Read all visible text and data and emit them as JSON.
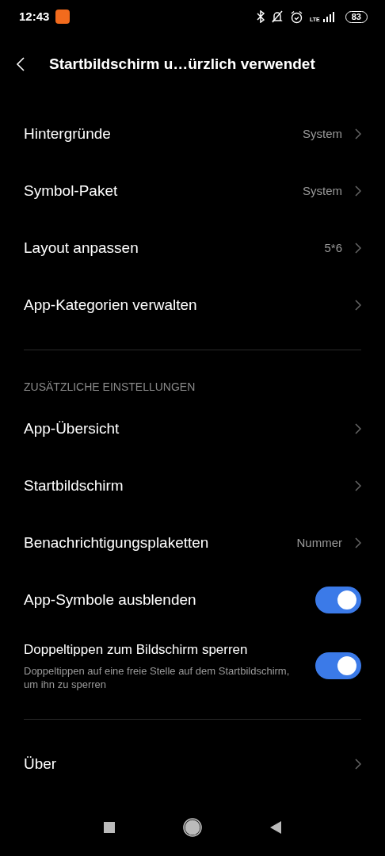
{
  "status_bar": {
    "time": "12:43",
    "network": "LTE",
    "battery": "83"
  },
  "header": {
    "title": "Startbildschirm u…ürzlich verwendet"
  },
  "sections": [
    {
      "items": [
        {
          "kind": "nav",
          "label": "Hintergründe",
          "value": "System"
        },
        {
          "kind": "nav",
          "label": "Symbol-Paket",
          "value": "System"
        },
        {
          "kind": "nav",
          "label": "Layout anpassen",
          "value": "5*6"
        },
        {
          "kind": "nav",
          "label": "App-Kategorien verwalten"
        }
      ]
    },
    {
      "title": "ZUSÄTZLICHE EINSTELLUNGEN",
      "items": [
        {
          "kind": "nav",
          "label": "App-Übersicht"
        },
        {
          "kind": "nav",
          "label": "Startbildschirm"
        },
        {
          "kind": "nav",
          "label": "Benachrichtigungsplaketten",
          "value": "Nummer"
        },
        {
          "kind": "toggle",
          "label": "App-Symbole ausblenden",
          "on": true
        },
        {
          "kind": "toggle",
          "label": "Doppeltippen zum Bildschirm sperren",
          "description": "Doppeltippen auf eine freie Stelle auf dem Startbildschirm, um ihn zu sperren",
          "on": true
        }
      ]
    },
    {
      "items": [
        {
          "kind": "nav",
          "label": "Über"
        }
      ]
    }
  ]
}
